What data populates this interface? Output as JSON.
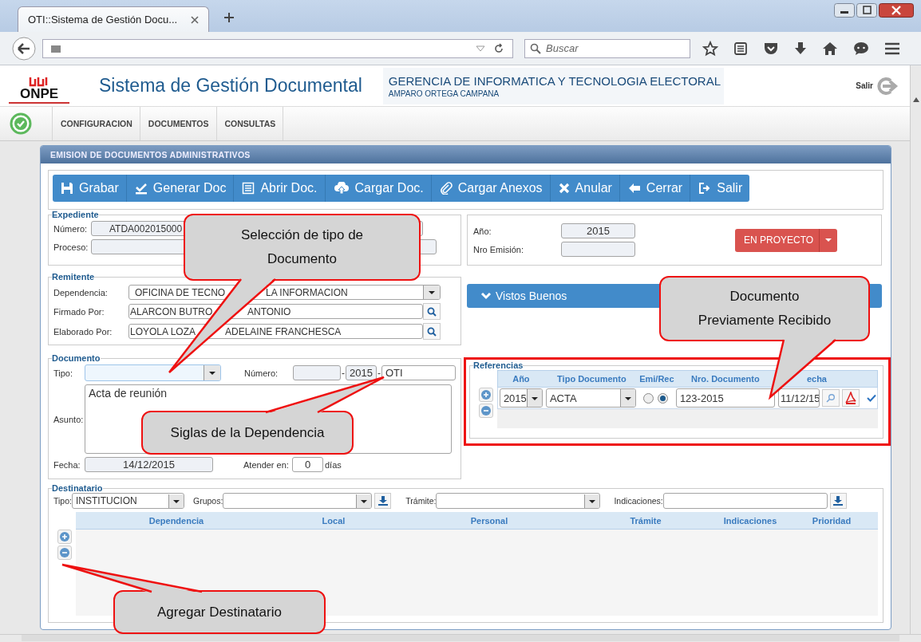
{
  "browser": {
    "tab_title": "OTI::Sistema de Gestión Docu...",
    "search_placeholder": "Buscar"
  },
  "header": {
    "logo": "ONPE",
    "title": "Sistema de Gestión Documental",
    "organization": "GERENCIA DE INFORMATICA Y TECNOLOGIA ELECTORAL",
    "user": "AMPARO ORTEGA CAMPANA",
    "logout": "Salir"
  },
  "menu": [
    "CONFIGURACION",
    "DOCUMENTOS",
    "CONSULTAS"
  ],
  "panel_title": "EMISION DE DOCUMENTOS ADMINISTRATIVOS",
  "toolbar": [
    {
      "label": "Grabar",
      "kind": "save"
    },
    {
      "label": "Generar Doc",
      "kind": "generate"
    },
    {
      "label": "Abrir Doc.",
      "kind": "open"
    },
    {
      "label": "Cargar Doc.",
      "kind": "upload"
    },
    {
      "label": "Cargar Anexos",
      "kind": "attach"
    },
    {
      "label": "Anular",
      "kind": "cancel"
    },
    {
      "label": "Cerrar",
      "kind": "back"
    },
    {
      "label": "Salir",
      "kind": "exit"
    }
  ],
  "expediente": {
    "legend": "Expediente",
    "numero_label": "Número:",
    "numero": "ATDA002015000",
    "proceso_label": "Proceso:"
  },
  "estado": {
    "anio_label": "Año:",
    "anio": "2015",
    "emision_label": "Nro Emisión:",
    "status": "EN PROYECTO"
  },
  "remitente": {
    "legend": "Remitente",
    "fields": [
      {
        "kind": "select",
        "label": "Dependencia:",
        "value_parts": [
          "OFICINA DE TECNO",
          "LA INFORMACION"
        ]
      },
      {
        "kind": "search",
        "label": "Firmado Por:",
        "value_parts": [
          "ALARCON BUTRO",
          "ANTONIO"
        ]
      },
      {
        "kind": "search",
        "label": "Elaborado Por:",
        "value_parts": [
          "LOYOLA LOZA",
          "ADELAINE FRANCHESCA"
        ]
      }
    ]
  },
  "vistos_buenos": "Vistos Buenos",
  "documento": {
    "legend": "Documento",
    "tipo_label": "Tipo:",
    "numero_label": "Número:",
    "separators": [
      "-",
      "-"
    ],
    "numero_year": "2015",
    "siglas": "OTI",
    "asunto_label": "Asunto:",
    "asunto": "Acta de reunión",
    "fecha_label": "Fecha:",
    "fecha": "14/12/2015",
    "atender_label": "Atender en:",
    "atender": "0",
    "dias": "días"
  },
  "referencias": {
    "legend": "Referencias",
    "columns": [
      "Año",
      "Tipo Documento",
      "Emi/Rec",
      "Nro. Documento",
      "echa"
    ],
    "rows": [
      {
        "year": "2015",
        "type": "ACTA",
        "radios": [
          {
            "selected": false
          },
          {
            "selected": true
          }
        ],
        "number": "123-2015",
        "date": "11/12/15",
        "validated": true
      }
    ]
  },
  "destinatario": {
    "legend": "Destinatario",
    "filters": [
      {
        "kind": "select",
        "label": "Tipo:",
        "value": "INSTITUCION"
      },
      {
        "kind": "select_add",
        "label": "Grupos:"
      },
      {
        "kind": "select",
        "label": "Trámite:"
      },
      {
        "kind": "text_add",
        "label": "Indicaciones:"
      }
    ],
    "columns": [
      "Dependencia",
      "Local",
      "Personal",
      "Trámite",
      "Indicaciones",
      "Prioridad"
    ]
  },
  "callouts": [
    {
      "lines": [
        "Selección de tipo de",
        "Documento"
      ]
    },
    {
      "lines": [
        "Documento",
        "Previamente Recibido"
      ]
    },
    {
      "lines": [
        "Siglas de la Dependencia"
      ]
    },
    {
      "lines": [
        "Agregar Destinatario"
      ]
    }
  ]
}
